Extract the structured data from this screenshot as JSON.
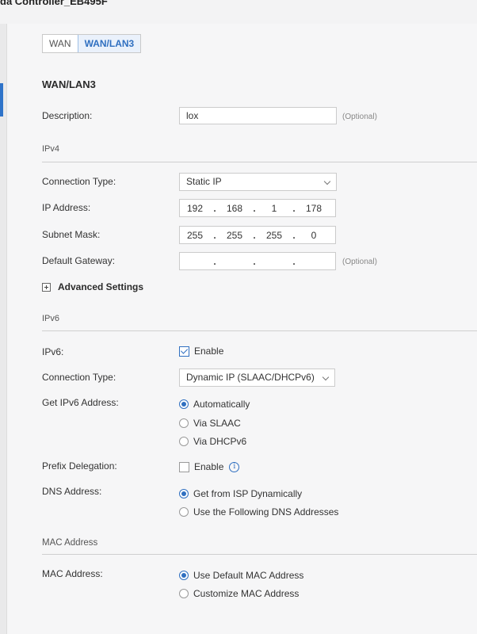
{
  "window": {
    "title": "da Controller_EB495F"
  },
  "tabs": [
    {
      "label": "WAN"
    },
    {
      "label": "WAN/LAN3"
    }
  ],
  "section_title": "WAN/LAN3",
  "description": {
    "label": "Description:",
    "value": "lox",
    "hint": "(Optional)"
  },
  "ipv4": {
    "group_label": "IPv4",
    "connection_type": {
      "label": "Connection Type:",
      "value": "Static IP"
    },
    "ip_address": {
      "label": "IP Address:",
      "octets": [
        "192",
        "168",
        "1",
        "178"
      ]
    },
    "subnet_mask": {
      "label": "Subnet Mask:",
      "octets": [
        "255",
        "255",
        "255",
        "0"
      ]
    },
    "default_gateway": {
      "label": "Default Gateway:",
      "octets": [
        "",
        "",
        "",
        ""
      ],
      "hint": "(Optional)"
    },
    "advanced_settings": "Advanced Settings"
  },
  "ipv6": {
    "group_label": "IPv6",
    "enable": {
      "label": "IPv6:",
      "checkbox_label": "Enable",
      "checked": true
    },
    "connection_type": {
      "label": "Connection Type:",
      "value": "Dynamic IP (SLAAC/DHCPv6)"
    },
    "get_address": {
      "label": "Get IPv6 Address:",
      "options": [
        "Automatically",
        "Via SLAAC",
        "Via DHCPv6"
      ],
      "selected": 0
    },
    "prefix_delegation": {
      "label": "Prefix Delegation:",
      "checkbox_label": "Enable",
      "checked": false,
      "icon": "info-icon"
    },
    "dns_address": {
      "label": "DNS Address:",
      "options": [
        "Get from ISP Dynamically",
        "Use the Following DNS Addresses"
      ],
      "selected": 0
    }
  },
  "mac": {
    "group_label": "MAC Address",
    "label": "MAC Address:",
    "options": [
      "Use Default MAC Address",
      "Customize MAC Address"
    ],
    "selected": 0
  },
  "colors": {
    "accent": "#2f6fc0",
    "panel_bg": "#f6f6f7"
  }
}
